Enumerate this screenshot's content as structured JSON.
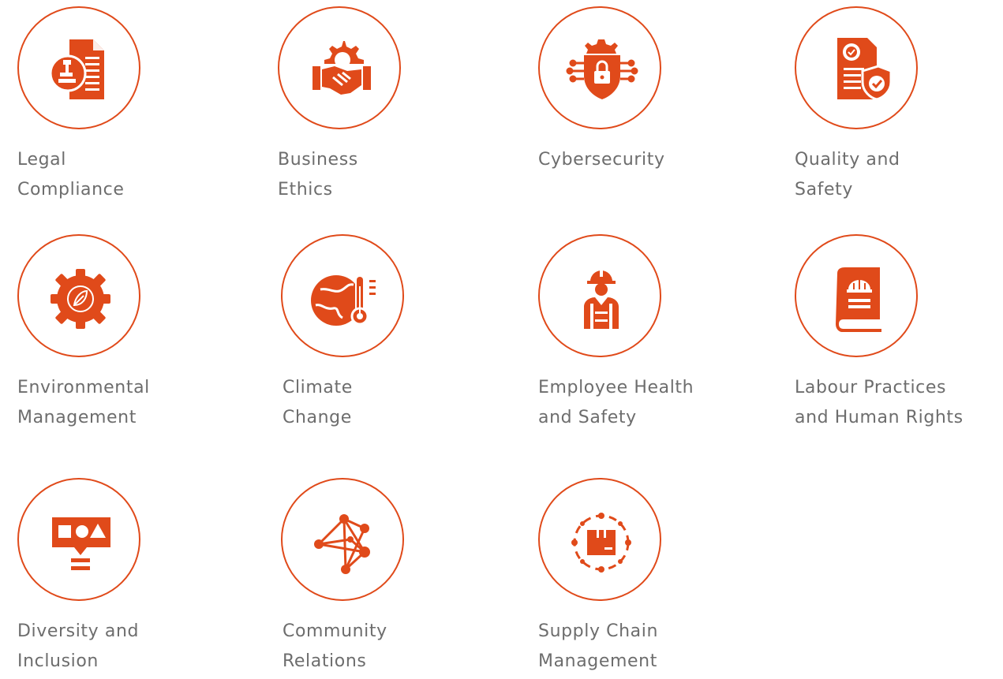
{
  "accent_color": "#e04a1a",
  "text_color": "#6d6d6d",
  "topics": [
    {
      "label": "Legal\nCompliance",
      "icon": "legal-document-gavel-icon"
    },
    {
      "label": "Business\nEthics",
      "icon": "handshake-gear-icon"
    },
    {
      "label": "Cybersecurity",
      "icon": "shield-lock-circuit-icon"
    },
    {
      "label": "Quality and\nSafety",
      "icon": "certificate-shield-check-icon"
    },
    {
      "label": "Environmental\nManagement",
      "icon": "gear-leaf-icon"
    },
    {
      "label": "Climate\nChange",
      "icon": "globe-thermometer-icon"
    },
    {
      "label": "Employee Health\nand Safety",
      "icon": "worker-hardhat-vest-icon"
    },
    {
      "label": "Labour Practices\nand Human Rights",
      "icon": "book-hardhat-icon"
    },
    {
      "label": "Diversity and\nInclusion",
      "icon": "shapes-speech-bubble-icon"
    },
    {
      "label": "Community\nRelations",
      "icon": "network-nodes-icon"
    },
    {
      "label": "Supply Chain\nManagement",
      "icon": "package-cycle-icon"
    }
  ]
}
